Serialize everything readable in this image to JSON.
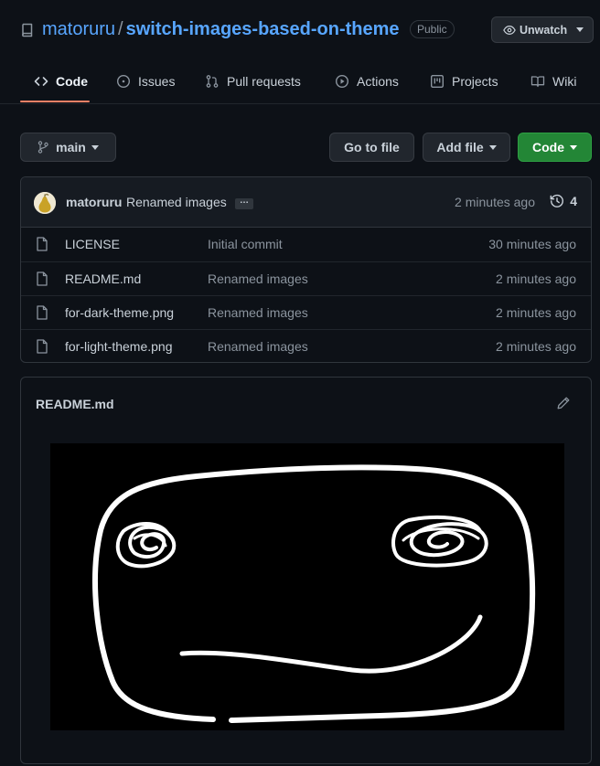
{
  "header": {
    "owner": "matoruru",
    "separator": "/",
    "repo": "switch-images-based-on-theme",
    "visibility": "Public",
    "watch_label": "Unwatch"
  },
  "tabs": [
    {
      "label": "Code",
      "icon": "code-icon",
      "active": true
    },
    {
      "label": "Issues",
      "icon": "issue-icon"
    },
    {
      "label": "Pull requests",
      "icon": "pull-request-icon"
    },
    {
      "label": "Actions",
      "icon": "play-icon"
    },
    {
      "label": "Projects",
      "icon": "project-icon"
    },
    {
      "label": "Wiki",
      "icon": "book-icon"
    }
  ],
  "toolbar": {
    "branch": "main",
    "go_to_file": "Go to file",
    "add_file": "Add file",
    "code": "Code"
  },
  "commit": {
    "author": "matoruru",
    "message": "Renamed images",
    "ellipsis": "…",
    "time": "2 minutes ago",
    "count": "4"
  },
  "files": [
    {
      "name": "LICENSE",
      "message": "Initial commit",
      "time": "30 minutes ago"
    },
    {
      "name": "README.md",
      "message": "Renamed images",
      "time": "2 minutes ago"
    },
    {
      "name": "for-dark-theme.png",
      "message": "Renamed images",
      "time": "2 minutes ago"
    },
    {
      "name": "for-light-theme.png",
      "message": "Renamed images",
      "time": "2 minutes ago"
    }
  ],
  "readme": {
    "title": "README.md"
  },
  "colors": {
    "background": "#0d1117",
    "link": "#58a6ff",
    "primary_button": "#238636",
    "active_tab_underline": "#f78166"
  }
}
